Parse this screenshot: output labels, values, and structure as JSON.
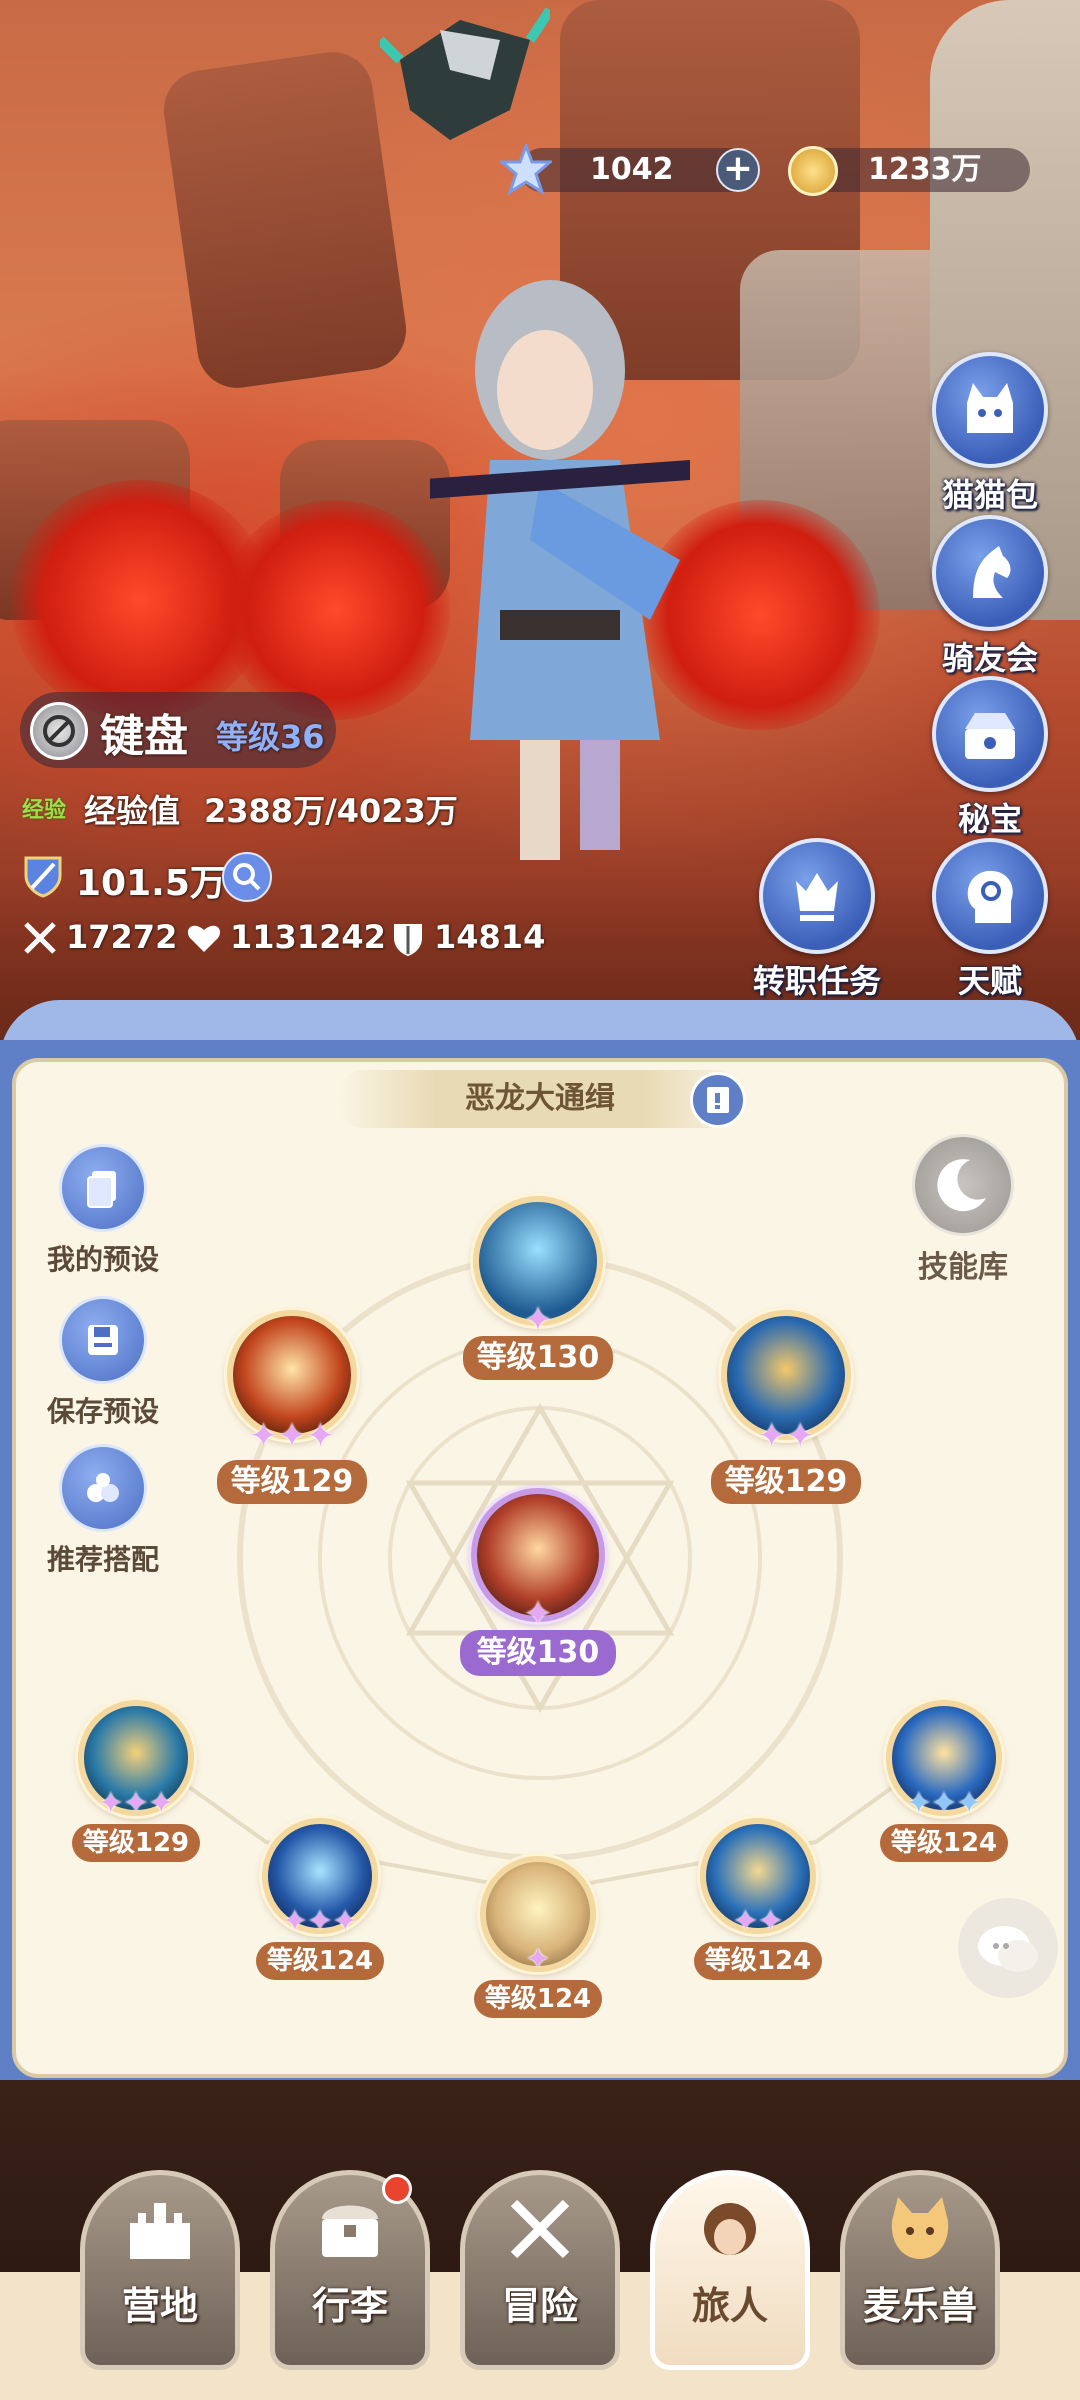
{
  "currency": {
    "crystal": "1042",
    "gold": "1233万"
  },
  "side_menu": [
    {
      "label": "猫猫包",
      "icon": "cat-bag-icon"
    },
    {
      "label": "骑友会",
      "icon": "horse-icon"
    },
    {
      "label": "秘宝",
      "icon": "treasure-icon"
    },
    {
      "label": "天赋",
      "icon": "talent-head-icon"
    },
    {
      "label": "转职任务",
      "icon": "job-change-icon"
    }
  ],
  "player": {
    "name": "键盘",
    "level": "等级36",
    "exp_tag": "经验",
    "exp_label": "经验值",
    "exp_value": "2388万/4023万",
    "power": "101.5万",
    "attack": "17272",
    "hp": "1131242",
    "defense": "14814"
  },
  "panel": {
    "title": "恶龙大通缉",
    "presets": [
      "我的预设",
      "保存预设",
      "推荐搭配"
    ],
    "skill_library": "技能库",
    "skills": [
      {
        "id": "top",
        "level": "等级130",
        "stars": "✦"
      },
      {
        "id": "left-upper",
        "level": "等级129",
        "stars": "✦✦✦"
      },
      {
        "id": "right-upper",
        "level": "等级129",
        "stars": "✦✦"
      },
      {
        "id": "center",
        "level": "等级130",
        "stars": "✦"
      },
      {
        "id": "outer-left",
        "level": "等级129",
        "stars": "✦✦✦"
      },
      {
        "id": "inner-left",
        "level": "等级124",
        "stars": "✦✦✦"
      },
      {
        "id": "bottom",
        "level": "等级124",
        "stars": "✦"
      },
      {
        "id": "inner-right",
        "level": "等级124",
        "stars": "✦✦"
      },
      {
        "id": "outer-right",
        "level": "等级124",
        "stars": "✦✦✦"
      }
    ]
  },
  "bottom_nav": [
    {
      "label": "营地",
      "active": false
    },
    {
      "label": "行李",
      "active": false,
      "badge": true
    },
    {
      "label": "冒险",
      "active": false
    },
    {
      "label": "旅人",
      "active": true
    },
    {
      "label": "麦乐兽",
      "active": false
    }
  ],
  "colors": {
    "accent_blue": "#5f7fc7",
    "level_brown": "#b46a3a",
    "level_purple": "#9a6ad0",
    "panel_bg": "#fbf5e6"
  }
}
